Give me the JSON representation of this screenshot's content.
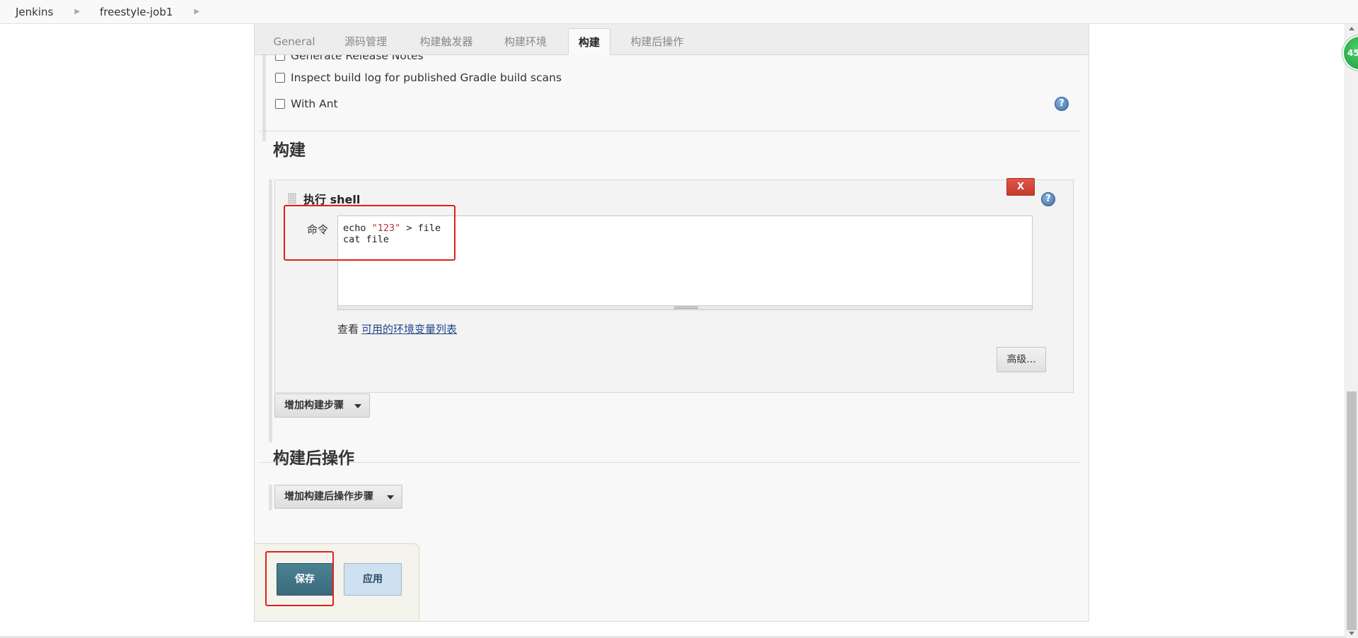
{
  "breadcrumb": {
    "items": [
      "Jenkins",
      "freestyle-job1"
    ]
  },
  "tabs": [
    "General",
    "源码管理",
    "构建触发器",
    "构建环境",
    "构建",
    "构建后操作"
  ],
  "active_tab": "构建",
  "partial_option": "Generate Release Notes",
  "options": [
    "Inspect build log for published Gradle build scans",
    "With Ant"
  ],
  "help_glyph": "?",
  "build_section": {
    "title": "构建",
    "step": {
      "title": "执行 shell",
      "delete_label": "X",
      "command_label": "命令",
      "command_lines": {
        "l1_pre": "echo ",
        "l1_str": "\"123\"",
        "l1_post": " > file",
        "l2": "cat file"
      },
      "env_prefix": "查看",
      "env_link": "可用的环境变量列表",
      "advanced_label": "高级..."
    },
    "add_step_label": "增加构建步骤"
  },
  "post_build_section": {
    "title": "构建后操作",
    "add_step_label": "增加构建后操作步骤"
  },
  "save_label": "保存",
  "apply_label": "应用",
  "badge_text": "45",
  "colors": {
    "annotation": "#e0201b",
    "save_button": "#3a6b7c",
    "delete_button": "#c63a2e",
    "link": "#204a87"
  }
}
